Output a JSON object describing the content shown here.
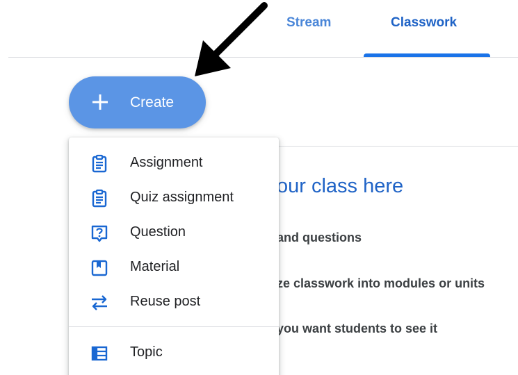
{
  "tabs": {
    "stream": "Stream",
    "classwork": "Classwork"
  },
  "create_button": {
    "label": "Create",
    "icon": "plus-icon"
  },
  "menu": {
    "items": [
      {
        "label": "Assignment",
        "icon": "assignment-icon"
      },
      {
        "label": "Quiz assignment",
        "icon": "quiz-assignment-icon"
      },
      {
        "label": "Question",
        "icon": "question-icon"
      },
      {
        "label": "Material",
        "icon": "material-icon"
      },
      {
        "label": "Reuse post",
        "icon": "reuse-icon"
      },
      {
        "label": "Topic",
        "icon": "topic-icon"
      }
    ]
  },
  "background": {
    "title": "our class here",
    "line1": "and questions",
    "line2": "ze classwork into modules or units",
    "line3": "you want students to see it"
  },
  "colors": {
    "accent": "#1a73e8",
    "create_button": "#5b95e5",
    "icon_blue": "#1967d2"
  }
}
